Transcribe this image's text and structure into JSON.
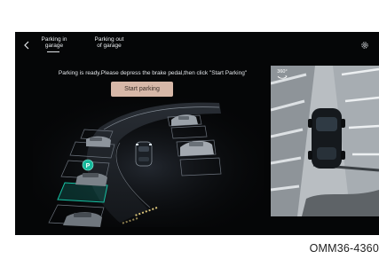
{
  "header": {
    "tabs": [
      {
        "label": "Parking in\ngarage",
        "active": true
      },
      {
        "label": "Parking out\nof garage",
        "active": false
      }
    ]
  },
  "main": {
    "status_message": "Parking is ready.Please depress the brake pedal,then click \"Start Parking\"",
    "start_button_label": "Start parking",
    "parking_marker": "P"
  },
  "camera_view": {
    "mode_badge": "360°"
  },
  "caption": "OMM36-4360",
  "colors": {
    "screen_background": "#050607",
    "start_button": "#d7b8a8",
    "parking_target": "#16c0a2"
  },
  "icons": [
    "back-arrow-icon",
    "settings-gear-icon",
    "rotate-360-icon"
  ]
}
